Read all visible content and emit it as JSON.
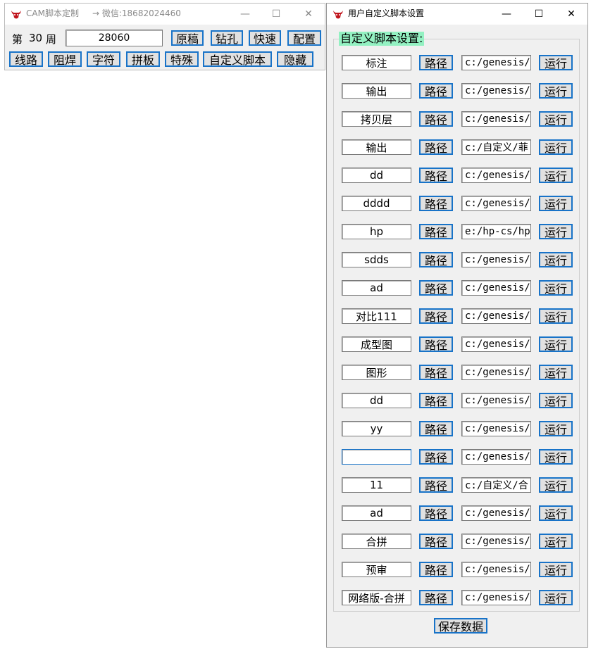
{
  "left_window": {
    "title": "CAM脚本定制",
    "wechat": "→ 微信:18682024460",
    "week_prefix": "第",
    "week_number": "30",
    "week_suffix": "周",
    "job_value": "28060",
    "row1_buttons": [
      "原稿",
      "钻孔",
      "快速",
      "配置"
    ],
    "row2_buttons": [
      "线路",
      "阻焊",
      "字符",
      "拼板",
      "特殊",
      "自定义脚本",
      "隐藏"
    ]
  },
  "right_window": {
    "title": "用户自定义脚本设置",
    "group_label": "自定义脚本设置:",
    "path_button": "路径",
    "run_button": "运行",
    "save_button": "保存数据",
    "rows": [
      {
        "name": "标注",
        "path": "c:/genesis/s"
      },
      {
        "name": "输出",
        "path": "c:/genesis/s"
      },
      {
        "name": "拷贝层",
        "path": "c:/genesis/s"
      },
      {
        "name": "输出",
        "path": "c:/自定义/菲"
      },
      {
        "name": "dd",
        "path": "c:/genesis/s"
      },
      {
        "name": "dddd",
        "path": "c:/genesis/s"
      },
      {
        "name": "hp",
        "path": "e:/hp-cs/hp-"
      },
      {
        "name": "sdds",
        "path": "c:/genesis/s"
      },
      {
        "name": "ad",
        "path": "c:/genesis/s"
      },
      {
        "name": "对比111",
        "path": "c:/genesis/s"
      },
      {
        "name": "成型图",
        "path": "c:/genesis/s"
      },
      {
        "name": "图形",
        "path": "c:/genesis/s"
      },
      {
        "name": "dd",
        "path": "c:/genesis/s"
      },
      {
        "name": "yy",
        "path": "c:/genesis/s"
      },
      {
        "name": "",
        "path": "c:/genesis/s"
      },
      {
        "name": "11",
        "path": "c:/自定义/合"
      },
      {
        "name": "ad",
        "path": "c:/genesis/s"
      },
      {
        "name": "合拼",
        "path": "c:/genesis/"
      },
      {
        "name": "预审",
        "path": "c:/genesis/"
      },
      {
        "name": "网络版-合拼",
        "path": "c:/genesis/s"
      }
    ]
  },
  "controls": {
    "minimize": "—",
    "maximize": "☐",
    "close": "✕"
  },
  "colors": {
    "accent": "#1873c8",
    "group_label_bg": "#93f1c2",
    "window_bg": "#f0f0f0",
    "active_title": "#000000",
    "inactive_title": "#8a8a8a"
  }
}
